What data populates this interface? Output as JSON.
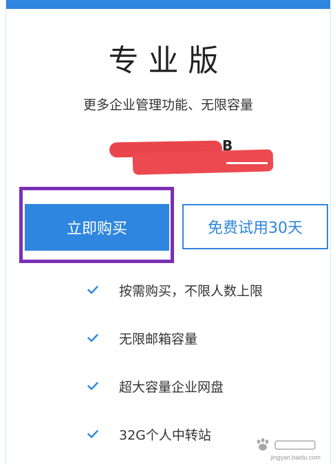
{
  "plan": {
    "title": "专业版",
    "subtitle": "更多企业管理功能、无限容量"
  },
  "price": {
    "redacted_fragment": "B"
  },
  "buttons": {
    "buy_label": "立即购买",
    "trial_label": "免费试用30天"
  },
  "features": [
    {
      "label": "按需购买，不限人数上限",
      "icon": "check-icon"
    },
    {
      "label": "无限邮箱容量",
      "icon": "check-icon"
    },
    {
      "label": "超大容量企业网盘",
      "icon": "check-icon"
    },
    {
      "label": "32G个人中转站",
      "icon": "check-icon"
    }
  ],
  "watermark": {
    "text": "jingyan.baidu.com"
  },
  "colors": {
    "accent": "#2e86de",
    "highlight": "#7a2fb5",
    "redaction": "#e9464c"
  }
}
